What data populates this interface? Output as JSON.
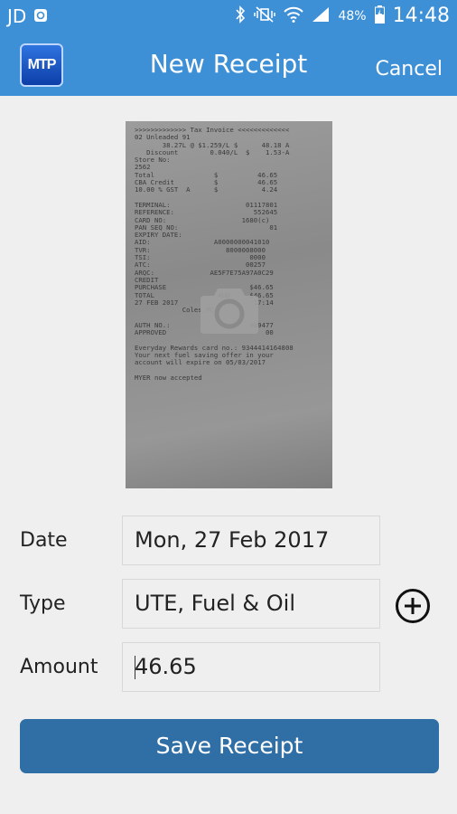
{
  "status_bar": {
    "carrier": "JD",
    "battery": "48%",
    "time": "14:48"
  },
  "app_bar": {
    "logo_text": "MTP",
    "title": "New Receipt",
    "cancel_label": "Cancel"
  },
  "receipt_photo": {
    "lines": [
      ">>>>>>>>>>>>> Tax Invoice <<<<<<<<<<<<<",
      "02 Unleaded 91",
      "       38.27L @ $1.259/L $      48.18 A",
      "   Discount        0.040/L  $    1.53-A",
      "Store No:",
      "2562",
      "Total               $          46.65",
      "CBA Credit          $          46.65",
      "10.00 % GST  A      $           4.24",
      "",
      "TERMINAL:                   01117801",
      "REFERENCE:                    552645",
      "CARD NO:                   1680(c)",
      "PAN SEQ NO:                       01",
      "EXPIRY DATE:",
      "AID:                A0000000041010",
      "TVR:                   8000008000",
      "TSI:                         0000",
      "ATC:                        00257",
      "ARQC:              AE5F7E75A97A0C29",
      "CREDIT",
      "PURCHASE                     $46.65",
      "TOTAL                AUD     $46.65",
      "27 FEB 2017                   17:14",
      "            Coles MC",
      "",
      "AUTH NO.:                    989477",
      "APPROVED                         00",
      "",
      "Everyday Rewards card no.: 9344414164808",
      "Your next fuel saving offer in your",
      "account will expire on 05/03/2017",
      "",
      "MYER now accepted"
    ]
  },
  "form": {
    "date_label": "Date",
    "date_value": "Mon, 27 Feb 2017",
    "type_label": "Type",
    "type_value": "UTE, Fuel & Oil",
    "amount_label": "Amount",
    "amount_value": "46.65"
  },
  "save_button": {
    "label": "Save Receipt"
  },
  "colors": {
    "primary": "#3d8fd6",
    "save_button": "#2f6fa6",
    "background": "#efefef"
  }
}
